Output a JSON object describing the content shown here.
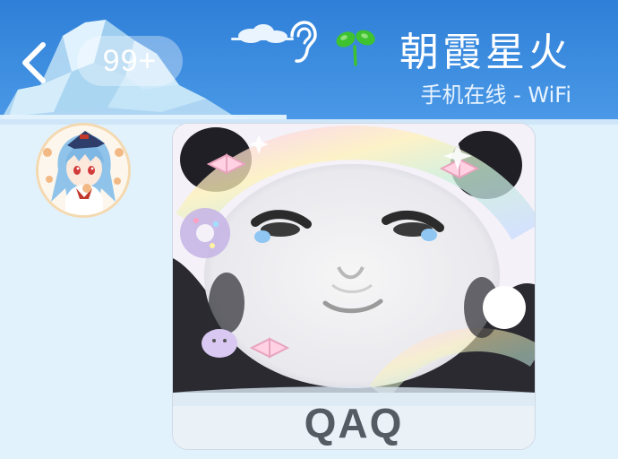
{
  "header": {
    "unread_badge": "99+",
    "contact_name": "朝霞星火",
    "contact_status": "手机在线 - WiFi"
  },
  "message": {
    "sticker_caption": "QAQ"
  },
  "icons": {
    "back": "chevron-left-icon",
    "earpiece": "ear-icon",
    "sprout": "sprout-icon"
  },
  "colors": {
    "header_blue": "#2f7fd8",
    "chat_background": "#e2f2fd",
    "sprout_green": "#3ec230"
  }
}
